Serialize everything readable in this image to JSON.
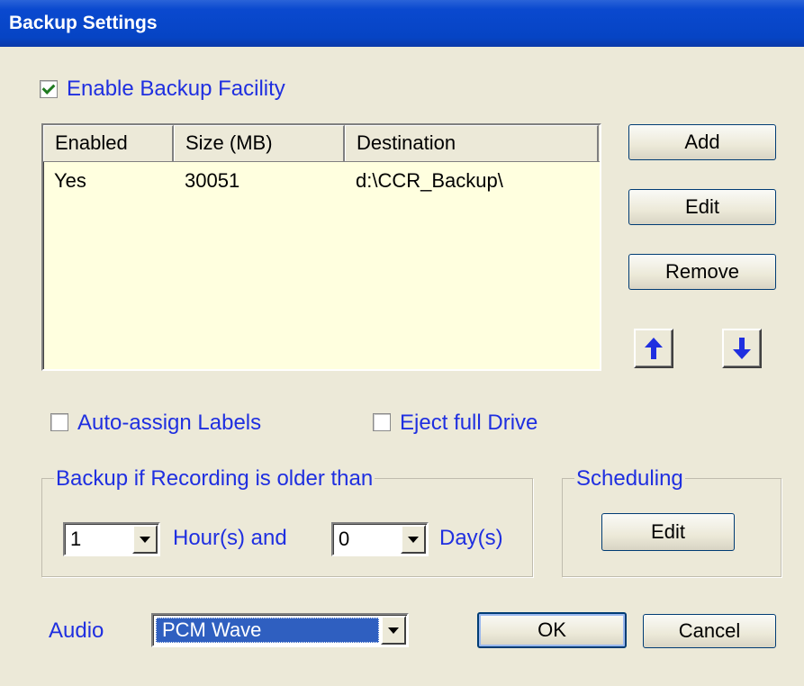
{
  "window": {
    "title": "Backup Settings"
  },
  "enable_backup": {
    "label": "Enable Backup Facility",
    "checked": true
  },
  "destinations": {
    "columns": [
      "Enabled",
      "Size (MB)",
      "Destination"
    ],
    "rows": [
      {
        "enabled": "Yes",
        "size": "30051",
        "destination": "d:\\CCR_Backup\\"
      }
    ]
  },
  "side_buttons": {
    "add": "Add",
    "edit": "Edit",
    "remove": "Remove"
  },
  "options": {
    "auto_assign": {
      "label": "Auto-assign Labels",
      "checked": false
    },
    "eject": {
      "label": "Eject full Drive",
      "checked": false
    }
  },
  "age_group": {
    "title": "Backup if Recording is older than",
    "hours_value": "1",
    "hours_label": "Hour(s) and",
    "days_value": "0",
    "days_label": "Day(s)"
  },
  "scheduling": {
    "title": "Scheduling",
    "edit": "Edit"
  },
  "audio": {
    "label": "Audio",
    "value": "PCM Wave"
  },
  "footer": {
    "ok": "OK",
    "cancel": "Cancel"
  },
  "colors": {
    "title_bar": "#0a49cf",
    "label_blue": "#1f2fe0",
    "list_bg": "#ffffdf",
    "selection": "#2f5fc0"
  }
}
